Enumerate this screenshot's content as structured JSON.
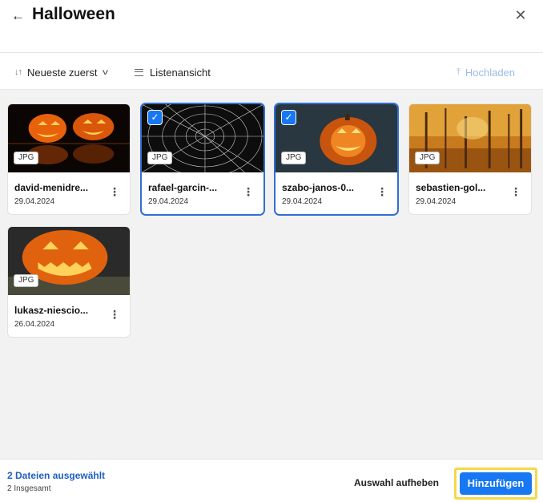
{
  "header": {
    "back_icon": "arrow-left-icon",
    "title": "Halloween",
    "close_icon": "close-icon"
  },
  "toolbar": {
    "sort_label": "Neueste zuerst",
    "view_label": "Listenansicht",
    "upload_label": "Hochladen",
    "upload_color": "#9bbbe3"
  },
  "files": [
    {
      "name": "david-menidre...",
      "date": "29.04.2024",
      "type": "JPG",
      "selected": false
    },
    {
      "name": "rafael-garcin-...",
      "date": "29.04.2024",
      "type": "JPG",
      "selected": true
    },
    {
      "name": "szabo-janos-0...",
      "date": "29.04.2024",
      "type": "JPG",
      "selected": true
    },
    {
      "name": "sebastien-gol...",
      "date": "29.04.2024",
      "type": "JPG",
      "selected": false
    },
    {
      "name": "lukasz-niescio...",
      "date": "26.04.2024",
      "type": "JPG",
      "selected": false
    }
  ],
  "footer": {
    "selected_label": "2 Dateien ausgewählt",
    "total_label": "2 Insgesamt",
    "deselect_label": "Auswahl aufheben",
    "add_label": "Hinzufügen"
  },
  "colors": {
    "accent": "#1877f2",
    "selected_text": "#1f5fbf",
    "highlight_frame": "#f5d84a",
    "content_bg": "#f2f2f2"
  }
}
